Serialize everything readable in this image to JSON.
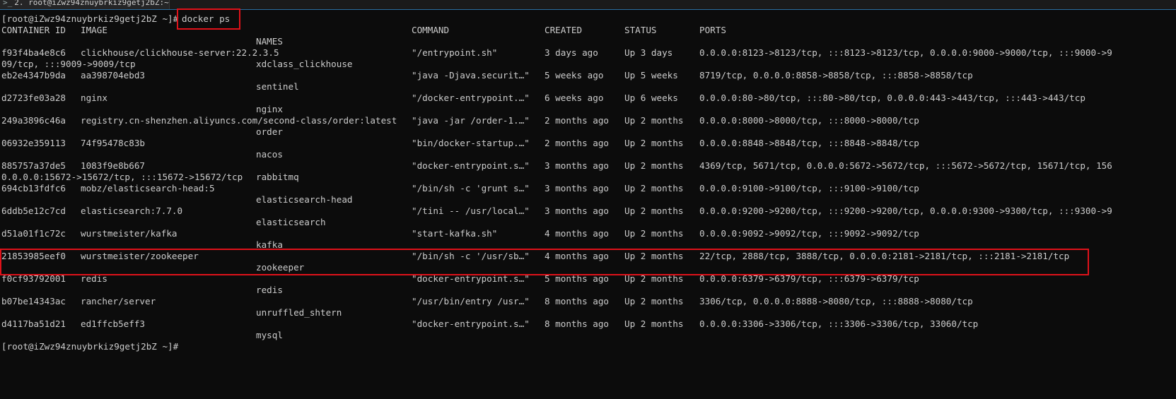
{
  "window": {
    "tab_icon": "terminal-icon",
    "tab_title": "2. root@iZwz94znuybrkiz9getj2bZ:~"
  },
  "prompt": {
    "text": "[root@iZwz94znuybrkiz9getj2bZ ~]#",
    "command": "docker ps"
  },
  "header": {
    "container_id": "CONTAINER ID",
    "image": "IMAGE",
    "command": "COMMAND",
    "created": "CREATED",
    "status": "STATUS",
    "ports": "PORTS",
    "names": "NAMES"
  },
  "containers": [
    {
      "id": "f93f4ba4e8c6",
      "image": "clickhouse/clickhouse-server:22.2.3.5",
      "command": "\"/entrypoint.sh\"",
      "created": "3 days ago",
      "status": "Up 3 days",
      "ports": "0.0.0.0:8123->8123/tcp, :::8123->8123/tcp, 0.0.0.0:9000->9000/tcp, :::9000->9",
      "wrap": "09/tcp, :::9009->9009/tcp",
      "name": "xdclass_clickhouse"
    },
    {
      "id": "eb2e4347b9da",
      "image": "aa398704ebd3",
      "command": "\"java -Djava.securit…\"",
      "created": "5 weeks ago",
      "status": "Up 5 weeks",
      "ports": "8719/tcp, 0.0.0.0:8858->8858/tcp, :::8858->8858/tcp",
      "wrap": "",
      "name": "sentinel"
    },
    {
      "id": "d2723fe03a28",
      "image": "nginx",
      "command": "\"/docker-entrypoint.…\"",
      "created": "6 weeks ago",
      "status": "Up 6 weeks",
      "ports": "0.0.0.0:80->80/tcp, :::80->80/tcp, 0.0.0.0:443->443/tcp, :::443->443/tcp",
      "wrap": "",
      "name": "nginx"
    },
    {
      "id": "249a3896c46a",
      "image": "registry.cn-shenzhen.aliyuncs.com/second-class/order:latest",
      "command": "\"java -jar /order-1.…\"",
      "created": "2 months ago",
      "status": "Up 2 months",
      "ports": "0.0.0.0:8000->8000/tcp, :::8000->8000/tcp",
      "wrap": "",
      "name": "order"
    },
    {
      "id": "06932e359113",
      "image": "74f95478c83b",
      "command": "\"bin/docker-startup.…\"",
      "created": "2 months ago",
      "status": "Up 2 months",
      "ports": "0.0.0.0:8848->8848/tcp, :::8848->8848/tcp",
      "wrap": "",
      "name": "nacos"
    },
    {
      "id": "885757a37de5",
      "image": "1083f9e8b667",
      "command": "\"docker-entrypoint.s…\"",
      "created": "3 months ago",
      "status": "Up 2 months",
      "ports": "4369/tcp, 5671/tcp, 0.0.0.0:5672->5672/tcp, :::5672->5672/tcp, 15671/tcp, 156",
      "wrap": "0.0.0.0:15672->15672/tcp, :::15672->15672/tcp",
      "name": "rabbitmq"
    },
    {
      "id": "694cb13fdfc6",
      "image": "mobz/elasticsearch-head:5",
      "command": "\"/bin/sh -c 'grunt s…\"",
      "created": "3 months ago",
      "status": "Up 2 months",
      "ports": "0.0.0.0:9100->9100/tcp, :::9100->9100/tcp",
      "wrap": "",
      "name": "elasticsearch-head"
    },
    {
      "id": "6ddb5e12c7cd",
      "image": "elasticsearch:7.7.0",
      "command": "\"/tini -- /usr/local…\"",
      "created": "3 months ago",
      "status": "Up 2 months",
      "ports": "0.0.0.0:9200->9200/tcp, :::9200->9200/tcp, 0.0.0.0:9300->9300/tcp, :::9300->9",
      "wrap": "",
      "name": "elasticsearch"
    },
    {
      "id": "d51a01f1c72c",
      "image": "wurstmeister/kafka",
      "command": "\"start-kafka.sh\"",
      "created": "4 months ago",
      "status": "Up 2 months",
      "ports": "0.0.0.0:9092->9092/tcp, :::9092->9092/tcp",
      "wrap": "",
      "name": "kafka"
    },
    {
      "id": "21853985eef0",
      "image": "wurstmeister/zookeeper",
      "command": "\"/bin/sh -c '/usr/sb…\"",
      "created": "4 months ago",
      "status": "Up 2 months",
      "ports": "22/tcp, 2888/tcp, 3888/tcp, 0.0.0.0:2181->2181/tcp, :::2181->2181/tcp",
      "wrap": "",
      "name": "zookeeper"
    },
    {
      "id": "f0cf93792001",
      "image": "redis",
      "command": "\"docker-entrypoint.s…\"",
      "created": "5 months ago",
      "status": "Up 2 months",
      "ports": "0.0.0.0:6379->6379/tcp, :::6379->6379/tcp",
      "wrap": "",
      "name": "redis"
    },
    {
      "id": "b07be14343ac",
      "image": "rancher/server",
      "command": "\"/usr/bin/entry /usr…\"",
      "created": "8 months ago",
      "status": "Up 2 months",
      "ports": "3306/tcp, 0.0.0.0:8888->8080/tcp, :::8888->8080/tcp",
      "wrap": "",
      "name": "unruffled_shtern"
    },
    {
      "id": "d4117ba51d21",
      "image": "ed1ffcb5eff3",
      "command": "\"docker-entrypoint.s…\"",
      "created": "8 months ago",
      "status": "Up 2 months",
      "ports": "0.0.0.0:3306->3306/tcp, :::3306->3306/tcp, 33060/tcp",
      "wrap": "",
      "name": "mysql"
    }
  ],
  "highlight_color": "#e0121a"
}
